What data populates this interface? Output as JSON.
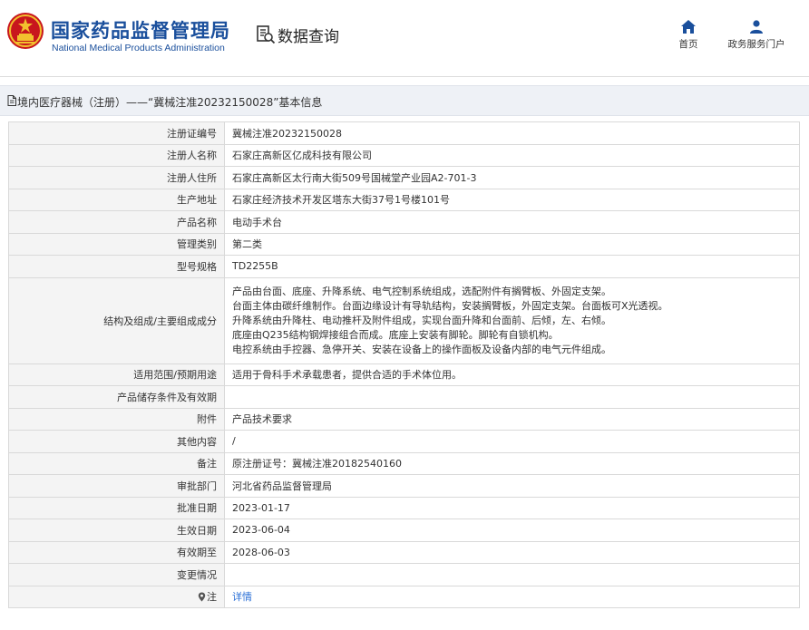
{
  "header": {
    "title_cn": "国家药品监督管理局",
    "title_en": "National Medical Products Administration",
    "query_label": "数据查询",
    "nav": {
      "home": "首页",
      "portal": "政务服务门户"
    }
  },
  "breadcrumb": {
    "text": "境内医疗器械（注册）——“冀械注准20232150028”基本信息"
  },
  "rows": [
    {
      "label": "注册证编号",
      "value": "冀械注准20232150028"
    },
    {
      "label": "注册人名称",
      "value": "石家庄高新区亿成科技有限公司"
    },
    {
      "label": "注册人住所",
      "value": "石家庄高新区太行南大街509号国械堂产业园A2-701-3"
    },
    {
      "label": "生产地址",
      "value": "石家庄经济技术开发区塔东大街37号1号楼101号"
    },
    {
      "label": "产品名称",
      "value": "电动手术台"
    },
    {
      "label": "管理类别",
      "value": "第二类"
    },
    {
      "label": "型号规格",
      "value": "TD2255B"
    },
    {
      "label": "结构及组成/主要组成成分",
      "lines": [
        "产品由台面、底座、升降系统、电气控制系统组成，选配附件有搁臂板、外固定支架。",
        "台面主体由碳纤维制作。台面边缘设计有导轨结构，安装搁臂板，外固定支架。台面板可X光透视。",
        "升降系统由升降柱、电动推杆及附件组成，实现台面升降和台面前、后倾，左、右倾。",
        "底座由Q235结构钢焊接组合而成。底座上安装有脚轮。脚轮有自锁机构。",
        "电控系统由手控器、急停开关、安装在设备上的操作面板及设备内部的电气元件组成。"
      ]
    },
    {
      "label": "适用范围/预期用途",
      "value": "适用于骨科手术承载患者，提供合适的手术体位用。"
    },
    {
      "label": "产品储存条件及有效期",
      "value": ""
    },
    {
      "label": "附件",
      "value": "产品技术要求"
    },
    {
      "label": "其他内容",
      "value": "/"
    },
    {
      "label": "备注",
      "value": "原注册证号：冀械注准20182540160"
    },
    {
      "label": "审批部门",
      "value": "河北省药品监督管理局"
    },
    {
      "label": "批准日期",
      "value": "2023-01-17"
    },
    {
      "label": "生效日期",
      "value": "2023-06-04"
    },
    {
      "label": "有效期至",
      "value": "2028-06-03"
    },
    {
      "label": "变更情况",
      "value": ""
    }
  ],
  "note_row": {
    "label": "注",
    "link": "详情"
  },
  "colors": {
    "brand_blue": "#1a4f9c",
    "link_blue": "#2a6fd6",
    "label_bg": "#f4f4f4",
    "crumb_bg": "#eef1f6"
  },
  "icons": {
    "logo": "national-emblem-icon",
    "query": "search-document-icon",
    "home": "home-icon",
    "portal": "user-icon",
    "breadcrumb": "document-icon",
    "note": "pin-icon"
  }
}
